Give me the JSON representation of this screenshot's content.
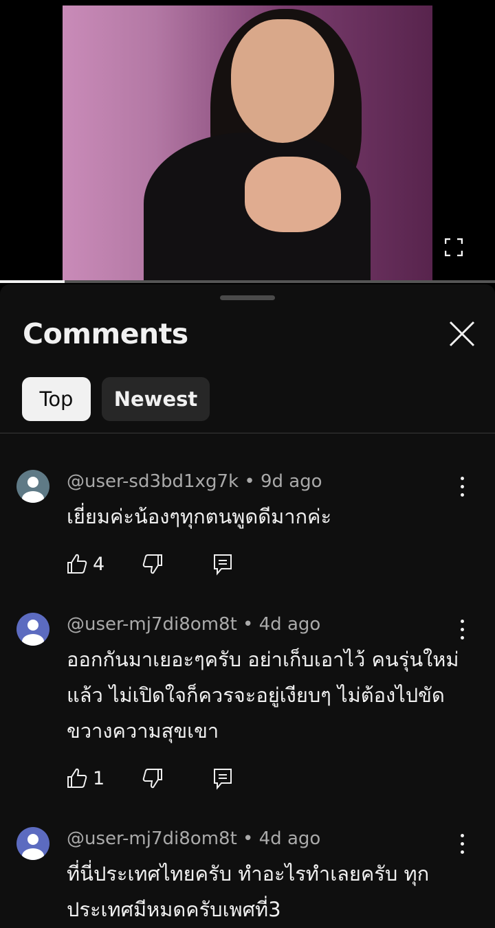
{
  "video": {
    "progress": 0.13
  },
  "sheet": {
    "title": "Comments",
    "filters": [
      "Top",
      "Newest"
    ],
    "selected_filter": "Top"
  },
  "comments": [
    {
      "user": "@user-sd3bd1xg7k",
      "time": "9d ago",
      "text": "เยี่ยมค่ะน้องๆทุกตนพูดดีมากค่ะ",
      "likes": "4",
      "avatar_color": "#5f7a86"
    },
    {
      "user": "@user-mj7di8om8t",
      "time": "4d ago",
      "text": "ออกกันมาเยอะๆครับ  อย่าเก็บเอาไว้  คนรุ่นใหม่แล้ว  ไม่เปิดใจก็ควรจะอยู่เงียบๆ  ไม่ต้องไปขัดขวางความสุขเขา",
      "likes": "1",
      "avatar_color": "#5c6bc0"
    },
    {
      "user": "@user-mj7di8om8t",
      "time": "4d ago",
      "text": "ที่นี่ประเทศไทยครับ  ทำอะไรทำเลยครับ  ทุกประเทศมีหมดครับเพศที่3",
      "likes": "",
      "avatar_color": "#5c6bc0"
    }
  ],
  "separator": " • "
}
